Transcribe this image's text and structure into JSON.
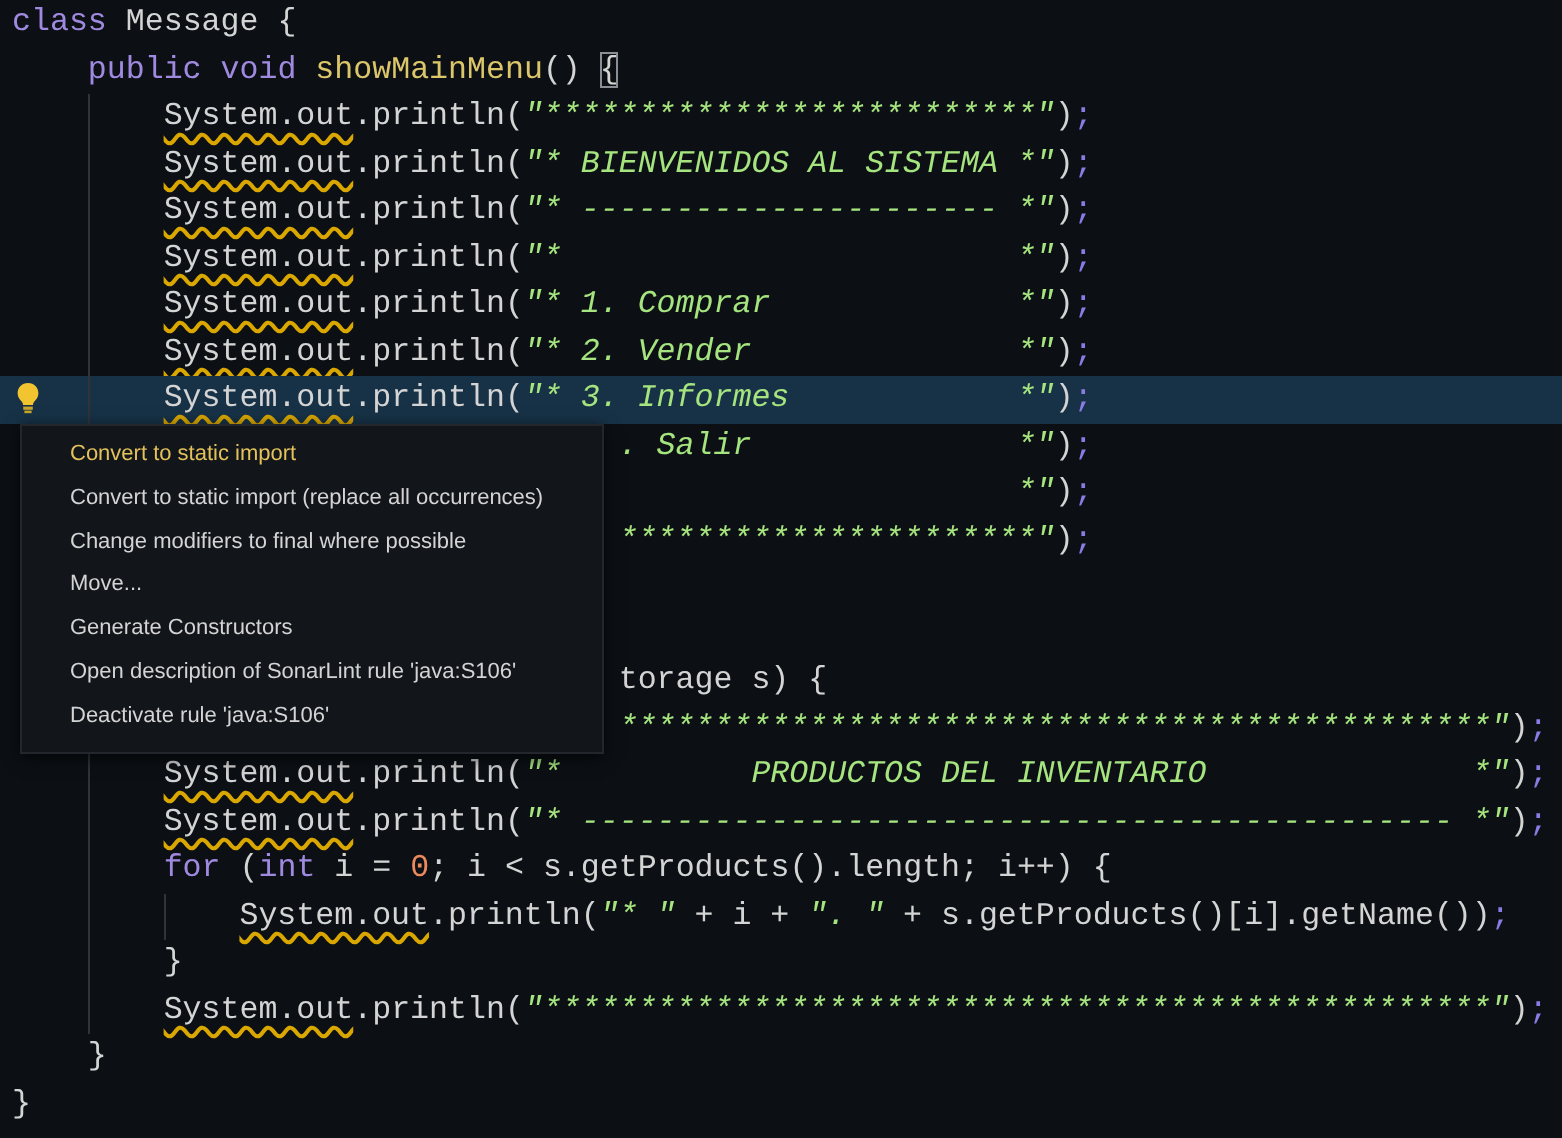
{
  "editor": {
    "lines": [
      {
        "kind": "code",
        "current": false,
        "tokens": [
          {
            "kind": "kw",
            "text": "class"
          },
          {
            "kind": "plain",
            "text": " Message {"
          }
        ],
        "children": [
          {
            "kind": "code",
            "current": false,
            "tokens": [
              {
                "kind": "kw",
                "text": "public void "
              },
              {
                "kind": "fn",
                "text": "showMainMenu"
              },
              {
                "kind": "plain",
                "text": "() "
              },
              {
                "kind": "match",
                "text": "{"
              }
            ],
            "children": [
              {
                "kind": "code",
                "current": false,
                "tokens": [
                  {
                    "kind": "warn",
                    "text": "System.out"
                  },
                  {
                    "kind": "plain",
                    "text": ".println("
                  },
                  {
                    "kind": "str",
                    "text": "\"**************************\""
                  },
                  {
                    "kind": "plain",
                    "text": ")"
                  },
                  {
                    "kind": "semi",
                    "text": ";"
                  }
                ]
              },
              {
                "kind": "code",
                "current": false,
                "tokens": [
                  {
                    "kind": "warn",
                    "text": "System.out"
                  },
                  {
                    "kind": "plain",
                    "text": ".println("
                  },
                  {
                    "kind": "str",
                    "text": "\"* BIENVENIDOS AL SISTEMA *\""
                  },
                  {
                    "kind": "plain",
                    "text": ")"
                  },
                  {
                    "kind": "semi",
                    "text": ";"
                  }
                ]
              },
              {
                "kind": "code",
                "current": false,
                "tokens": [
                  {
                    "kind": "warn",
                    "text": "System.out"
                  },
                  {
                    "kind": "plain",
                    "text": ".println("
                  },
                  {
                    "kind": "str",
                    "text": "\"* ---------------------- *\""
                  },
                  {
                    "kind": "plain",
                    "text": ")"
                  },
                  {
                    "kind": "semi",
                    "text": ";"
                  }
                ]
              },
              {
                "kind": "code",
                "current": false,
                "tokens": [
                  {
                    "kind": "warn",
                    "text": "System.out"
                  },
                  {
                    "kind": "plain",
                    "text": ".println("
                  },
                  {
                    "kind": "str",
                    "text": "\"*                        *\""
                  },
                  {
                    "kind": "plain",
                    "text": ")"
                  },
                  {
                    "kind": "semi",
                    "text": ";"
                  }
                ]
              },
              {
                "kind": "code",
                "current": false,
                "tokens": [
                  {
                    "kind": "warn",
                    "text": "System.out"
                  },
                  {
                    "kind": "plain",
                    "text": ".println("
                  },
                  {
                    "kind": "str",
                    "text": "\"* 1. Comprar             *\""
                  },
                  {
                    "kind": "plain",
                    "text": ")"
                  },
                  {
                    "kind": "semi",
                    "text": ";"
                  }
                ]
              },
              {
                "kind": "code",
                "current": false,
                "tokens": [
                  {
                    "kind": "warn",
                    "text": "System.out"
                  },
                  {
                    "kind": "plain",
                    "text": ".println("
                  },
                  {
                    "kind": "str",
                    "text": "\"* 2. Vender              *\""
                  },
                  {
                    "kind": "plain",
                    "text": ")"
                  },
                  {
                    "kind": "semi",
                    "text": ";"
                  }
                ]
              },
              {
                "kind": "code",
                "current": true,
                "tokens": [
                  {
                    "kind": "warn",
                    "text": "System.out"
                  },
                  {
                    "kind": "plain",
                    "text": ".println("
                  },
                  {
                    "kind": "str",
                    "text": "\"* 3. Informes            *\""
                  },
                  {
                    "kind": "plain",
                    "text": ")"
                  },
                  {
                    "kind": "semi",
                    "text": ";"
                  }
                ]
              },
              {
                "kind": "covered",
                "current": false,
                "tokens": [
                  {
                    "kind": "str",
                    "text": ". Salir              *\""
                  },
                  {
                    "kind": "plain",
                    "text": ")"
                  },
                  {
                    "kind": "semi",
                    "text": ";"
                  }
                ]
              },
              {
                "kind": "covered",
                "current": false,
                "tokens": [
                  {
                    "kind": "str",
                    "text": "                     *\""
                  },
                  {
                    "kind": "plain",
                    "text": ")"
                  },
                  {
                    "kind": "semi",
                    "text": ";"
                  }
                ]
              },
              {
                "kind": "covered",
                "current": false,
                "tokens": [
                  {
                    "kind": "str",
                    "text": "**********************\""
                  },
                  {
                    "kind": "plain",
                    "text": ")"
                  },
                  {
                    "kind": "semi",
                    "text": ";"
                  }
                ]
              }
            ]
          },
          {
            "kind": "blank",
            "current": false
          },
          {
            "kind": "blank",
            "current": false
          },
          {
            "kind": "covered",
            "current": false,
            "tokens": [
              {
                "kind": "plain",
                "text": "torage s) {"
              }
            ],
            "children": [
              {
                "kind": "covered",
                "current": false,
                "tokens": [
                  {
                    "kind": "str",
                    "text": "**********************************************\""
                  },
                  {
                    "kind": "plain",
                    "text": ")"
                  },
                  {
                    "kind": "semi",
                    "text": ";"
                  }
                ]
              },
              {
                "kind": "code",
                "current": false,
                "tokens": [
                  {
                    "kind": "warn",
                    "text": "System.out"
                  },
                  {
                    "kind": "plain",
                    "text": ".println("
                  },
                  {
                    "kind": "str",
                    "text": "\"*          PRODUCTOS DEL INVENTARIO              *\""
                  },
                  {
                    "kind": "plain",
                    "text": ")"
                  },
                  {
                    "kind": "semi",
                    "text": ";"
                  }
                ]
              },
              {
                "kind": "code",
                "current": false,
                "tokens": [
                  {
                    "kind": "warn",
                    "text": "System.out"
                  },
                  {
                    "kind": "plain",
                    "text": ".println("
                  },
                  {
                    "kind": "str",
                    "text": "\"* ---------------------------------------------- *\""
                  },
                  {
                    "kind": "plain",
                    "text": ")"
                  },
                  {
                    "kind": "semi",
                    "text": ";"
                  }
                ]
              },
              {
                "kind": "code",
                "current": false,
                "tokens": [
                  {
                    "kind": "kw",
                    "text": "for"
                  },
                  {
                    "kind": "plain",
                    "text": " ("
                  },
                  {
                    "kind": "kw",
                    "text": "int"
                  },
                  {
                    "kind": "plain",
                    "text": " i = "
                  },
                  {
                    "kind": "num",
                    "text": "0"
                  },
                  {
                    "kind": "plain",
                    "text": "; i < s.getProducts().length; i++) {"
                  }
                ],
                "children": [
                  {
                    "kind": "code",
                    "current": false,
                    "tokens": [
                      {
                        "kind": "warn",
                        "text": "System.out"
                      },
                      {
                        "kind": "plain",
                        "text": ".println("
                      },
                      {
                        "kind": "str",
                        "text": "\"* \""
                      },
                      {
                        "kind": "plain",
                        "text": " + i + "
                      },
                      {
                        "kind": "str",
                        "text": "\". \""
                      },
                      {
                        "kind": "plain",
                        "text": " + s.getProducts()[i].getName())"
                      },
                      {
                        "kind": "semi",
                        "text": ";"
                      }
                    ]
                  }
                ]
              },
              {
                "kind": "code",
                "current": false,
                "tokens": [
                  {
                    "kind": "plain",
                    "text": "}"
                  }
                ]
              },
              {
                "kind": "code",
                "current": false,
                "tokens": [
                  {
                    "kind": "warn",
                    "text": "System.out"
                  },
                  {
                    "kind": "plain",
                    "text": ".println("
                  },
                  {
                    "kind": "str",
                    "text": "\"**************************************************\""
                  },
                  {
                    "kind": "plain",
                    "text": ")"
                  },
                  {
                    "kind": "semi",
                    "text": ";"
                  }
                ]
              }
            ]
          },
          {
            "kind": "code",
            "current": false,
            "tokens": [
              {
                "kind": "plain",
                "text": "}"
              }
            ]
          }
        ]
      },
      {
        "kind": "code",
        "current": false,
        "tokens": [
          {
            "kind": "plain",
            "text": "}"
          }
        ]
      }
    ]
  },
  "context_menu": {
    "items": [
      {
        "label": "Convert to static import",
        "selected": true
      },
      {
        "label": "Convert to static import (replace all occurrences)",
        "selected": false
      },
      {
        "label": "Change modifiers to final where possible",
        "selected": false
      },
      {
        "label": "Move...",
        "selected": false
      },
      {
        "label": "Generate Constructors",
        "selected": false
      },
      {
        "label": "Open description of SonarLint rule 'java:S106'",
        "selected": false
      },
      {
        "label": "Deactivate rule 'java:S106'",
        "selected": false
      }
    ]
  }
}
